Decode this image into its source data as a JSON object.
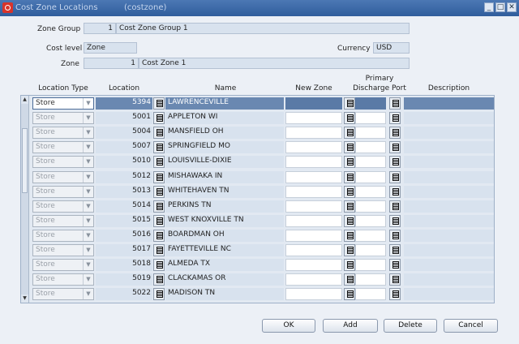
{
  "window": {
    "title": "Cost Zone Locations",
    "form_code": "(costzone)",
    "controls": {
      "minimize": "_",
      "maximize": "□",
      "close": "✕"
    }
  },
  "header": {
    "zone_group_label": "Zone Group",
    "zone_group_id": "1",
    "zone_group_name": "Cost Zone Group 1",
    "cost_level_label": "Cost level",
    "cost_level_value": "Zone",
    "currency_label": "Currency",
    "currency_value": "USD",
    "zone_label": "Zone",
    "zone_id": "1",
    "zone_name": "Cost Zone 1"
  },
  "columns": {
    "location_type": "Location Type",
    "location": "Location",
    "name": "Name",
    "new_zone": "New Zone",
    "primary": "Primary",
    "discharge_port": "Discharge Port",
    "description": "Description"
  },
  "rows": [
    {
      "type": "Store",
      "location": "5394",
      "name": "LAWRENCEVILLE",
      "selected": true
    },
    {
      "type": "Store",
      "location": "5001",
      "name": "APPLETON WI"
    },
    {
      "type": "Store",
      "location": "5004",
      "name": "MANSFIELD  OH"
    },
    {
      "type": "Store",
      "location": "5007",
      "name": "SPRINGFIELD MO"
    },
    {
      "type": "Store",
      "location": "5010",
      "name": "LOUISVILLE-DIXIE"
    },
    {
      "type": "Store",
      "location": "5012",
      "name": "MISHAWAKA  IN"
    },
    {
      "type": "Store",
      "location": "5013",
      "name": "WHITEHAVEN TN"
    },
    {
      "type": "Store",
      "location": "5014",
      "name": "PERKINS TN"
    },
    {
      "type": "Store",
      "location": "5015",
      "name": "WEST KNOXVILLE  TN"
    },
    {
      "type": "Store",
      "location": "5016",
      "name": "BOARDMAN OH"
    },
    {
      "type": "Store",
      "location": "5017",
      "name": "FAYETTEVILLE NC"
    },
    {
      "type": "Store",
      "location": "5018",
      "name": "ALMEDA TX"
    },
    {
      "type": "Store",
      "location": "5019",
      "name": "CLACKAMAS OR"
    },
    {
      "type": "Store",
      "location": "5022",
      "name": "MADISON TN"
    }
  ],
  "buttons": {
    "ok": "OK",
    "add": "Add",
    "delete": "Delete",
    "cancel": "Cancel"
  }
}
